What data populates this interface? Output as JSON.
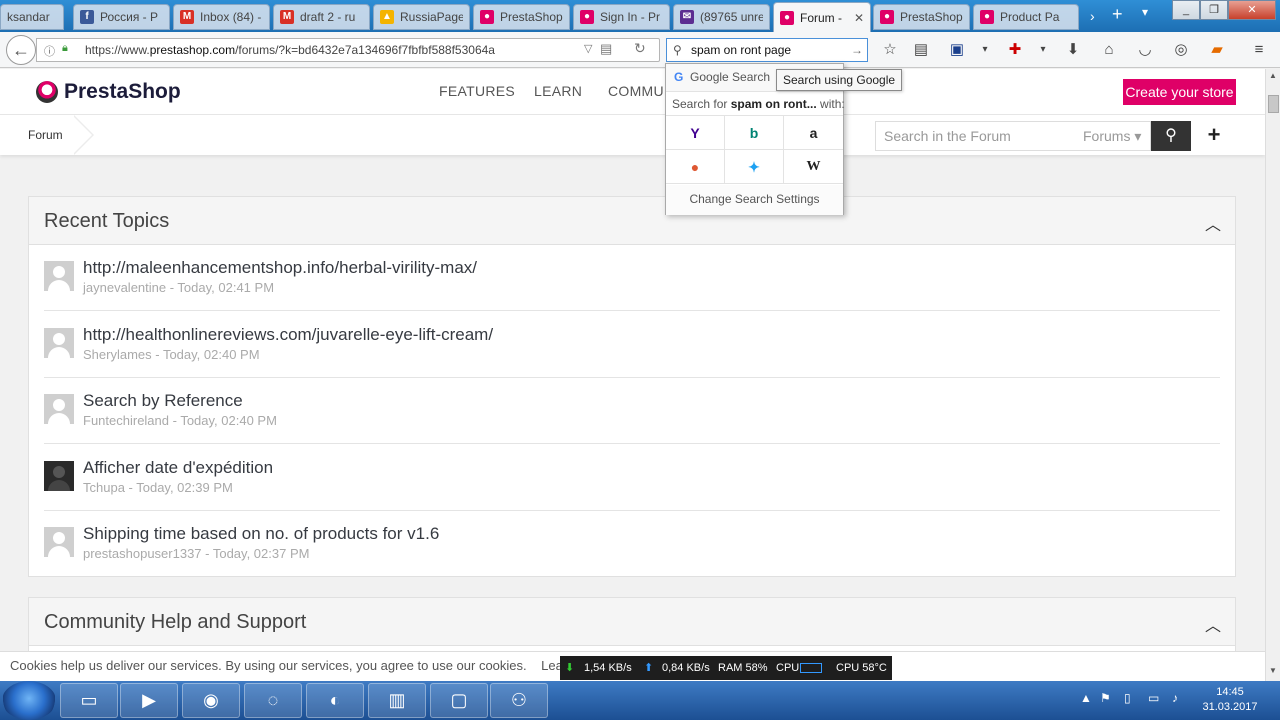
{
  "browser": {
    "tabs": [
      {
        "label": "ksandar",
        "icon": "tab-icon"
      },
      {
        "label": "Россия - P",
        "icon": "facebook-icon"
      },
      {
        "label": "Inbox (84) -",
        "icon": "gmail-icon"
      },
      {
        "label": "draft 2 - ru",
        "icon": "gmail-icon"
      },
      {
        "label": "RussiaPage",
        "icon": "drive-icon"
      },
      {
        "label": "PrestaShop",
        "icon": "prestashop-icon"
      },
      {
        "label": "Sign In - Pr",
        "icon": "prestashop-icon"
      },
      {
        "label": "(89765 unre",
        "icon": "mail-icon"
      },
      {
        "label": "Forum -",
        "icon": "prestashop-icon",
        "active": true
      },
      {
        "label": "PrestaShop",
        "icon": "prestashop-icon"
      },
      {
        "label": "Product Pa",
        "icon": "prestashop-icon"
      }
    ],
    "url_prefix": "https://www.",
    "url_host": "prestashop.com",
    "url_path": "/forums/?k=bd6432e7a134696f7fbfbf588f53064a",
    "search_value": "spam on ront page"
  },
  "search_dropdown": {
    "engine_label": "Google Search",
    "search_for_prefix": "Search for ",
    "search_for_term": "spam on ront...",
    "search_for_suffix": " with:",
    "engines": [
      {
        "name": "yahoo-icon",
        "glyph": "Y",
        "color": "#400090"
      },
      {
        "name": "bing-icon",
        "glyph": "b",
        "color": "#008373"
      },
      {
        "name": "amazon-icon",
        "glyph": "a",
        "color": "#222222"
      },
      {
        "name": "duckduckgo-icon",
        "glyph": "●",
        "color": "#de5833"
      },
      {
        "name": "twitter-icon",
        "glyph": "✦",
        "color": "#1da1f2"
      },
      {
        "name": "wikipedia-icon",
        "glyph": "W",
        "color": "#222222"
      }
    ],
    "change_settings": "Change Search Settings",
    "tooltip": "Search using Google"
  },
  "site": {
    "logo": "PrestaShop",
    "nav": [
      "FEATURES",
      "LEARN",
      "COMMUN"
    ],
    "cta": "Create your store",
    "breadcrumb": "Forum",
    "forum_search_placeholder": "Search in the Forum",
    "forum_select": "Forums ▾"
  },
  "recent_topics": {
    "title": "Recent Topics",
    "items": [
      {
        "title": "http://maleenhancementshop.info/herbal-virility-max/",
        "meta": "jaynevalentine - Today, 02:41 PM"
      },
      {
        "title": "http://healthonlinereviews.com/juvarelle-eye-lift-cream/",
        "meta": "Sherylames - Today, 02:40 PM"
      },
      {
        "title": "Search by Reference",
        "meta": "Funtechireland - Today, 02:40 PM"
      },
      {
        "title": "Afficher date d'expédition",
        "meta": "Tchupa - Today, 02:39 PM"
      },
      {
        "title": "Shipping time based on no. of products for v1.6",
        "meta": "prestashopuser1337 - Today, 02:37 PM"
      }
    ]
  },
  "community": {
    "title": "Community Help and Support"
  },
  "cookie": {
    "text": "Cookies help us deliver our services. By using our services, you agree to use our cookies.",
    "link": "Learn m"
  },
  "meter": {
    "down": "1,54 KB/s",
    "up": "0,84 KB/s",
    "ram": "RAM 58%",
    "cpu_label": "CPU",
    "cpu_temp": "CPU 58°C"
  },
  "taskbar": {
    "time": "14:45",
    "date": "31.03.2017"
  }
}
